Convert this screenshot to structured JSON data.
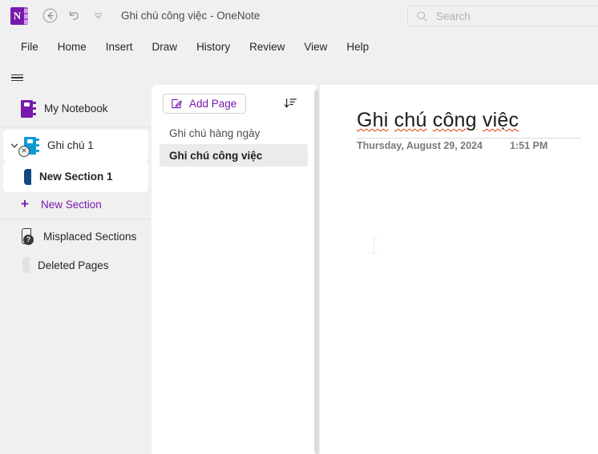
{
  "titlebar": {
    "app_icon": "onenote-logo",
    "back_icon": "back-arrow-icon",
    "undo_icon": "undo-icon",
    "customize_icon": "chevron-down-icon",
    "title": "Ghi chú công việc  -  OneNote"
  },
  "search": {
    "icon": "search-icon",
    "placeholder": "Search",
    "value": ""
  },
  "ribbon": {
    "tabs": [
      {
        "label": "File"
      },
      {
        "label": "Home"
      },
      {
        "label": "Insert"
      },
      {
        "label": "Draw"
      },
      {
        "label": "History"
      },
      {
        "label": "Review"
      },
      {
        "label": "View"
      },
      {
        "label": "Help"
      }
    ]
  },
  "sidebar": {
    "hamburger_icon": "hamburger-menu-icon",
    "notebook": {
      "label": "My Notebook",
      "icon": "notebook-purple-icon"
    },
    "open_notebook": {
      "label": "Ghi chú 1",
      "icon": "notebook-blue-icon",
      "chevron_icon": "chevron-expanded-icon",
      "error_badge": "sync-error-icon",
      "error_glyph": "✕"
    },
    "section": {
      "label": "New Section 1",
      "icon": "section-tab-icon"
    },
    "new_section": {
      "label": "New Section",
      "plus": "+",
      "icon": "plus-icon"
    },
    "misplaced": {
      "label": "Misplaced Sections",
      "icon": "misplaced-sections-icon",
      "badge_glyph": "?"
    },
    "deleted": {
      "label": "Deleted Pages",
      "icon": "section-tab-grey-icon"
    }
  },
  "pagelist": {
    "add_page": {
      "label": "Add Page",
      "icon": "new-page-icon"
    },
    "sort_icon": "sort-descending-icon",
    "pages": [
      {
        "label": "Ghi chú hàng ngày",
        "active": false
      },
      {
        "label": "Ghi chú công việc",
        "active": true
      }
    ]
  },
  "content": {
    "title": "Ghi chú công việc",
    "title_words": [
      "Ghi",
      "chú",
      "công",
      "việc"
    ],
    "date": "Thursday, August 29, 2024",
    "time": "1:51 PM",
    "cursor_icon": "text-ibeam-cursor"
  },
  "colors": {
    "accent_purple": "#7719aa",
    "notebook_blue": "#0c9ad6",
    "section_blue": "#13477d",
    "spellcheck_red": "#d83b01",
    "chrome_grey": "#f0f0f0",
    "selected_page_grey": "#ebebeb"
  }
}
